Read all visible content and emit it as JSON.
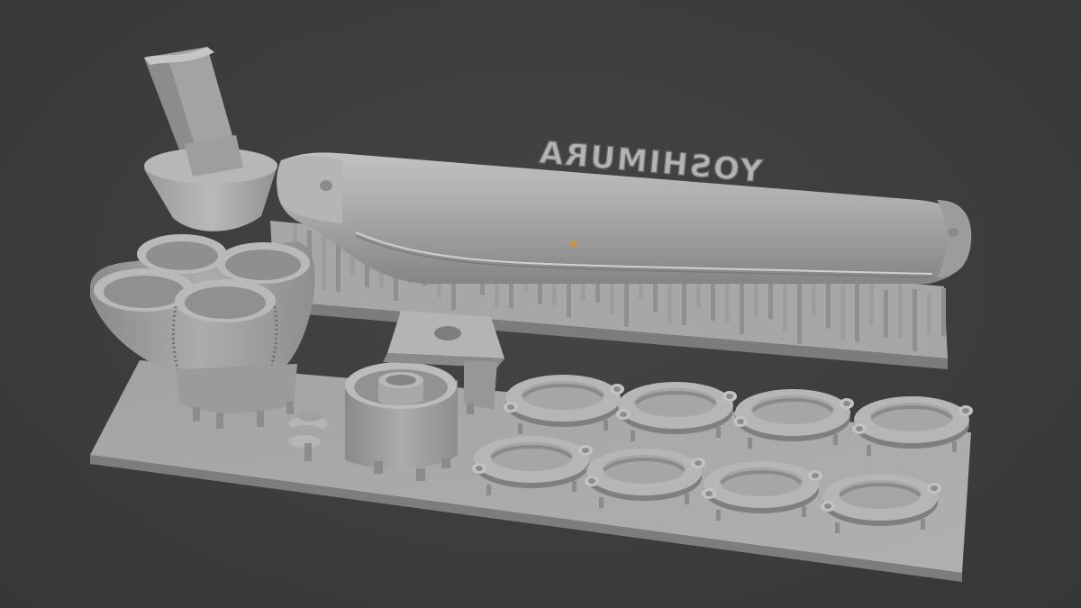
{
  "scene": {
    "background": "#3d3d3d",
    "material_color": "#a8a8a8",
    "highlight_color": "#c4c4c4",
    "shadow_color": "#7a7a7a",
    "marker_color": "#e08a28",
    "muffler_engraving": "YOSHIMURA"
  }
}
